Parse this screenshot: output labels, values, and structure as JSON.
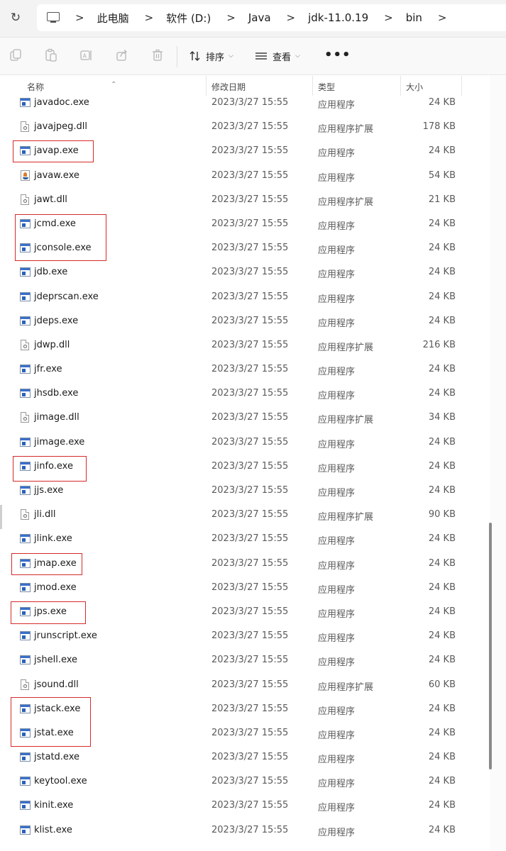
{
  "address_bar": {
    "breadcrumbs": [
      "此电脑",
      "软件 (D:)",
      "Java",
      "jdk-11.0.19",
      "bin"
    ],
    "separator": ">"
  },
  "toolbar": {
    "sort_label": "排序",
    "view_label": "查看",
    "more_label": "•••",
    "icons": [
      "copy-icon",
      "paste-icon",
      "rename-icon",
      "share-icon",
      "delete-icon"
    ]
  },
  "columns": {
    "name": "名称",
    "date": "修改日期",
    "type": "类型",
    "size": "大小"
  },
  "files": [
    {
      "name": "javadoc.exe",
      "date": "2023/3/27 15:55",
      "type": "应用程序",
      "size": "24 KB",
      "icon": "exe",
      "highlighted": false
    },
    {
      "name": "javajpeg.dll",
      "date": "2023/3/27 15:55",
      "type": "应用程序扩展",
      "size": "178 KB",
      "icon": "dll",
      "highlighted": false
    },
    {
      "name": "javap.exe",
      "date": "2023/3/27 15:55",
      "type": "应用程序",
      "size": "24 KB",
      "icon": "exe",
      "highlighted": true
    },
    {
      "name": "javaw.exe",
      "date": "2023/3/27 15:55",
      "type": "应用程序",
      "size": "54 KB",
      "icon": "java",
      "highlighted": false
    },
    {
      "name": "jawt.dll",
      "date": "2023/3/27 15:55",
      "type": "应用程序扩展",
      "size": "21 KB",
      "icon": "dll",
      "highlighted": false
    },
    {
      "name": "jcmd.exe",
      "date": "2023/3/27 15:55",
      "type": "应用程序",
      "size": "24 KB",
      "icon": "exe",
      "highlighted": true
    },
    {
      "name": "jconsole.exe",
      "date": "2023/3/27 15:55",
      "type": "应用程序",
      "size": "24 KB",
      "icon": "exe",
      "highlighted": true
    },
    {
      "name": "jdb.exe",
      "date": "2023/3/27 15:55",
      "type": "应用程序",
      "size": "24 KB",
      "icon": "exe",
      "highlighted": false
    },
    {
      "name": "jdeprscan.exe",
      "date": "2023/3/27 15:55",
      "type": "应用程序",
      "size": "24 KB",
      "icon": "exe",
      "highlighted": false
    },
    {
      "name": "jdeps.exe",
      "date": "2023/3/27 15:55",
      "type": "应用程序",
      "size": "24 KB",
      "icon": "exe",
      "highlighted": false
    },
    {
      "name": "jdwp.dll",
      "date": "2023/3/27 15:55",
      "type": "应用程序扩展",
      "size": "216 KB",
      "icon": "dll",
      "highlighted": false
    },
    {
      "name": "jfr.exe",
      "date": "2023/3/27 15:55",
      "type": "应用程序",
      "size": "24 KB",
      "icon": "exe",
      "highlighted": false
    },
    {
      "name": "jhsdb.exe",
      "date": "2023/3/27 15:55",
      "type": "应用程序",
      "size": "24 KB",
      "icon": "exe",
      "highlighted": false
    },
    {
      "name": "jimage.dll",
      "date": "2023/3/27 15:55",
      "type": "应用程序扩展",
      "size": "34 KB",
      "icon": "dll",
      "highlighted": false
    },
    {
      "name": "jimage.exe",
      "date": "2023/3/27 15:55",
      "type": "应用程序",
      "size": "24 KB",
      "icon": "exe",
      "highlighted": false
    },
    {
      "name": "jinfo.exe",
      "date": "2023/3/27 15:55",
      "type": "应用程序",
      "size": "24 KB",
      "icon": "exe",
      "highlighted": true
    },
    {
      "name": "jjs.exe",
      "date": "2023/3/27 15:55",
      "type": "应用程序",
      "size": "24 KB",
      "icon": "exe",
      "highlighted": false
    },
    {
      "name": "jli.dll",
      "date": "2023/3/27 15:55",
      "type": "应用程序扩展",
      "size": "90 KB",
      "icon": "dll",
      "highlighted": false
    },
    {
      "name": "jlink.exe",
      "date": "2023/3/27 15:55",
      "type": "应用程序",
      "size": "24 KB",
      "icon": "exe",
      "highlighted": false
    },
    {
      "name": "jmap.exe",
      "date": "2023/3/27 15:55",
      "type": "应用程序",
      "size": "24 KB",
      "icon": "exe",
      "highlighted": true
    },
    {
      "name": "jmod.exe",
      "date": "2023/3/27 15:55",
      "type": "应用程序",
      "size": "24 KB",
      "icon": "exe",
      "highlighted": false
    },
    {
      "name": "jps.exe",
      "date": "2023/3/27 15:55",
      "type": "应用程序",
      "size": "24 KB",
      "icon": "exe",
      "highlighted": true
    },
    {
      "name": "jrunscript.exe",
      "date": "2023/3/27 15:55",
      "type": "应用程序",
      "size": "24 KB",
      "icon": "exe",
      "highlighted": false
    },
    {
      "name": "jshell.exe",
      "date": "2023/3/27 15:55",
      "type": "应用程序",
      "size": "24 KB",
      "icon": "exe",
      "highlighted": false
    },
    {
      "name": "jsound.dll",
      "date": "2023/3/27 15:55",
      "type": "应用程序扩展",
      "size": "60 KB",
      "icon": "dll",
      "highlighted": false
    },
    {
      "name": "jstack.exe",
      "date": "2023/3/27 15:55",
      "type": "应用程序",
      "size": "24 KB",
      "icon": "exe",
      "highlighted": true
    },
    {
      "name": "jstat.exe",
      "date": "2023/3/27 15:55",
      "type": "应用程序",
      "size": "24 KB",
      "icon": "exe",
      "highlighted": true
    },
    {
      "name": "jstatd.exe",
      "date": "2023/3/27 15:55",
      "type": "应用程序",
      "size": "24 KB",
      "icon": "exe",
      "highlighted": false
    },
    {
      "name": "keytool.exe",
      "date": "2023/3/27 15:55",
      "type": "应用程序",
      "size": "24 KB",
      "icon": "exe",
      "highlighted": false
    },
    {
      "name": "kinit.exe",
      "date": "2023/3/27 15:55",
      "type": "应用程序",
      "size": "24 KB",
      "icon": "exe",
      "highlighted": false
    },
    {
      "name": "klist.exe",
      "date": "2023/3/27 15:55",
      "type": "应用程序",
      "size": "24 KB",
      "icon": "exe",
      "highlighted": false
    }
  ],
  "colors": {
    "highlight_box": "#d62a2a",
    "exe_icon_blue": "#3a6fc9",
    "java_icon_orange": "#e07b2a"
  }
}
